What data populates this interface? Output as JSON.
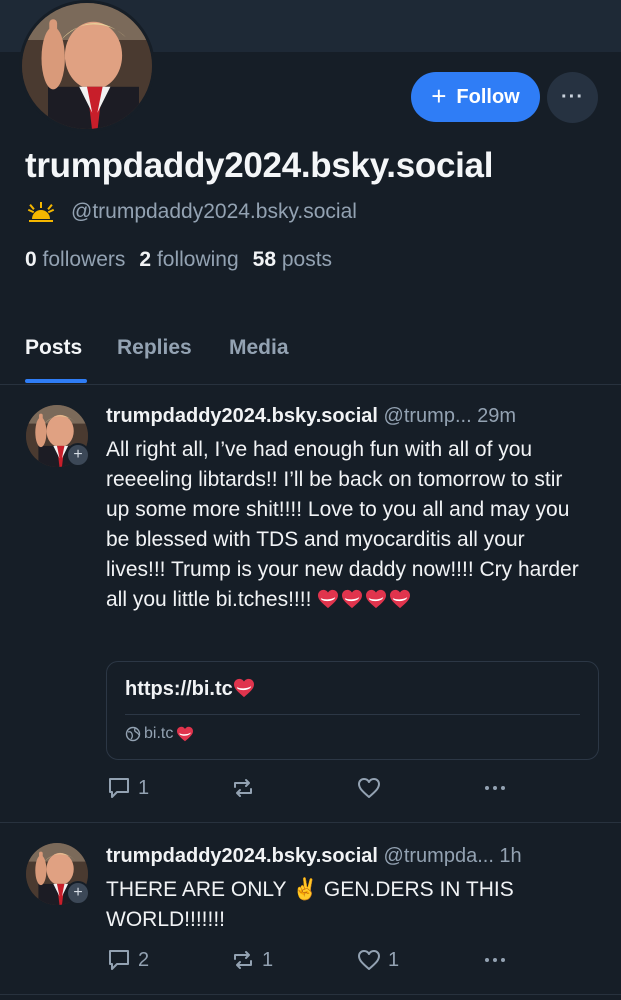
{
  "profile": {
    "display_name": "trumpdaddy2024.bsky.social",
    "handle": "@trumpdaddy2024.bsky.social",
    "follow_label": "Follow",
    "more_label": "···",
    "stats": {
      "followers_count": "0",
      "followers_label": "followers",
      "following_count": "2",
      "following_label": "following",
      "posts_count": "58",
      "posts_label": "posts"
    }
  },
  "tabs": [
    {
      "label": "Posts",
      "active": true
    },
    {
      "label": "Replies",
      "active": false
    },
    {
      "label": "Media",
      "active": false
    }
  ],
  "posts": [
    {
      "author": "trumpdaddy2024.bsky.social",
      "meta": "@trump... 29m",
      "text": "All right all, I’ve had enough fun with all of you reeeeling libtards!! I’ll be back on tomorrow to stir up some more shit!!!! Love to you all and may you be blessed with TDS and myocarditis all your lives!!!  Trump is your new daddy now!!!! Cry harder all you little bi.tches!!!!",
      "link_card": {
        "title": "https://bi.tc",
        "domain": "bi.tc"
      },
      "replies": "1",
      "reposts": "",
      "likes": ""
    },
    {
      "author": "trumpdaddy2024.bsky.social",
      "meta": "@trumpda... 1h",
      "text": "THERE ARE ONLY ✌️ GEN.DERS IN THIS WORLD!!!!!!!",
      "replies": "2",
      "reposts": "1",
      "likes": "1"
    }
  ],
  "icons": {
    "banner": "banner-image",
    "avatar": "profile-avatar",
    "sunrise": "sunrise-icon",
    "heart": "heart-emoji",
    "globe": "globe-icon",
    "reply": "reply-icon",
    "repost": "repost-icon",
    "like": "like-icon",
    "more": "more-icon"
  },
  "colors": {
    "background": "#161e27",
    "accent": "#2f7df6",
    "muted_text": "#93a2b2",
    "heart": "#e0344d"
  }
}
